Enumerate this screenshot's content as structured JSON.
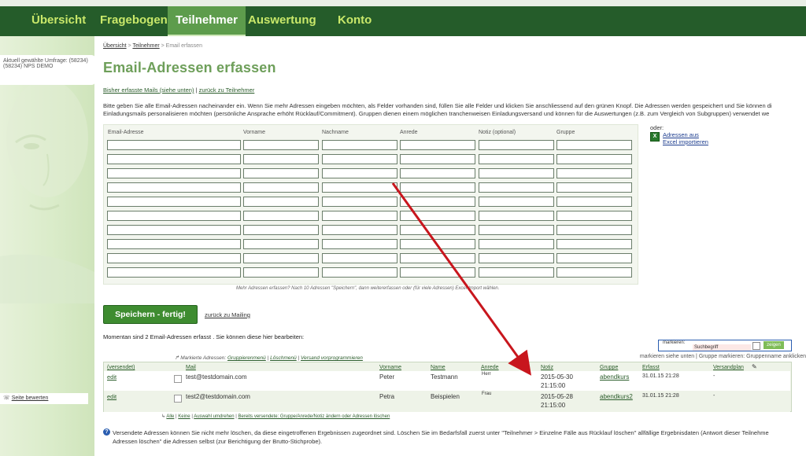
{
  "nav": {
    "items": [
      {
        "label": "Übersicht"
      },
      {
        "label": "Fragebogen"
      },
      {
        "label": "Teilnehmer"
      },
      {
        "label": "Auswertung"
      },
      {
        "label": "Konto"
      }
    ]
  },
  "sidebar": {
    "survey_line1": "Aktuell gewählte Umfrage: (58234)",
    "survey_line2": "(58234) NPS DEMO",
    "rate_link": "Seite bewerten"
  },
  "breadcrumb": {
    "item1": "Übersicht",
    "sep": " > ",
    "item2": "Teilnehmer",
    "current": " > Email erfassen"
  },
  "page_title": "Email-Adressen erfassen",
  "top_links": {
    "captured": "Bisher erfasste Mails (siehe unten)",
    "sep": " | ",
    "back": "zurück zu Teilnehmer"
  },
  "intro": {
    "line1": "Bitte geben Sie alle Email-Adressen nacheinander ein. Wenn Sie mehr Adressen eingeben möchten, als Felder vorhanden sind, füllen Sie alle Felder und klicken Sie anschliessend auf den grünen Knopf. Die Adressen werden gespeichert und Sie können di",
    "line2": "Einladungsmails personalisieren möchten (persönliche Ansprache erhöht Rücklauf/Commitment). Gruppen dienen einem möglichen tranchenweisen Einladungsversand und können für die Auswertungen (z.B. zum Vergleich von Subgruppen) verwendet we"
  },
  "form": {
    "headers": [
      "Email-Adresse",
      "Vorname",
      "Nachname",
      "Anrede",
      "Notiz (optional)",
      "Gruppe"
    ],
    "rows": 10
  },
  "excel": {
    "oder": "oder:",
    "link_line1": "Adressen aus",
    "link_line2": "Excel importieren"
  },
  "form_note": "Mehr Adressen erfassen? Nach 10 Adressen \"Speichern\", dann weitererfassen oder (für viele Adressen) Excel-Import wählen.",
  "save_button": "Speichern - fertig!",
  "mailing_link": "zurück zu Mailing",
  "count_text": "Momentan sind 2 Email-Adressen erfasst . Sie können diese hier bearbeiten:",
  "search": {
    "label": "markieren:",
    "placeholder": "Suchbegriff",
    "button": "zeigen"
  },
  "mark_bar": {
    "prefix": "Markierte Adressen: ",
    "group_menu": "Gruppierenmenü",
    "delete_menu": "Löschmenü",
    "schedule": "Versand vorprogrammieren",
    "sep": " | ",
    "right": "markieren siehe unten | Gruppe markieren: Gruppenname anklicken"
  },
  "table": {
    "headers": {
      "versendet": "(versendet)",
      "mail": "Mail",
      "vorname": "Vorname",
      "name": "Name",
      "anrede": "Anrede",
      "notiz": "Notiz",
      "gruppe": "Gruppe",
      "erfasst": "Erfasst",
      "versandplan": "Versandplan"
    },
    "rows": [
      {
        "edit": "edit",
        "mail": "test@testdomain.com",
        "vorname": "Peter",
        "name": "Testmann",
        "anrede": "Herr",
        "notiz1": "2015-05-30",
        "notiz2": "21:15:00",
        "gruppe": "abendkurs",
        "erfasst": "31.01.15 21:28",
        "versandplan": "-"
      },
      {
        "edit": "edit",
        "mail": "test2@testdomain.com",
        "vorname": "Petra",
        "name": "Beispielen",
        "anrede": "Frau",
        "notiz1": "2015-05-28",
        "notiz2": "21:15:00",
        "gruppe": "abendkurs2",
        "erfasst": "31.01.15 21:28",
        "versandplan": "-"
      }
    ]
  },
  "select_links": {
    "all": "Alle",
    "none": "Keine",
    "invert": "Auswahl umdrehen",
    "sent": "Bereits versendete: Gruppe/Anrede/Notiz ändern oder Adressen löschen",
    "sep": " | "
  },
  "info": {
    "line1": "Versendete Adressen können Sie nicht mehr löschen, da diese eingetroffenen Ergebnissen zugeordnet sind. Löschen Sie im Bedarfsfall zuerst unter \"Teilnehmer > Einzelne Fälle aus Rücklauf löschen\" allfällige Ergebnisdaten (Antwort dieser Teilnehme",
    "line2": "Adressen löschen\" die Adressen selbst (zur Berichtigung der Brutto-Stichprobe)."
  },
  "colors": {
    "nav_bg": "#255c2a",
    "nav_active": "#5d9c4c",
    "nav_text": "#c9e86a",
    "title": "#6e9f5a",
    "save_button": "#3e8c30",
    "arrow": "#c8161d"
  }
}
